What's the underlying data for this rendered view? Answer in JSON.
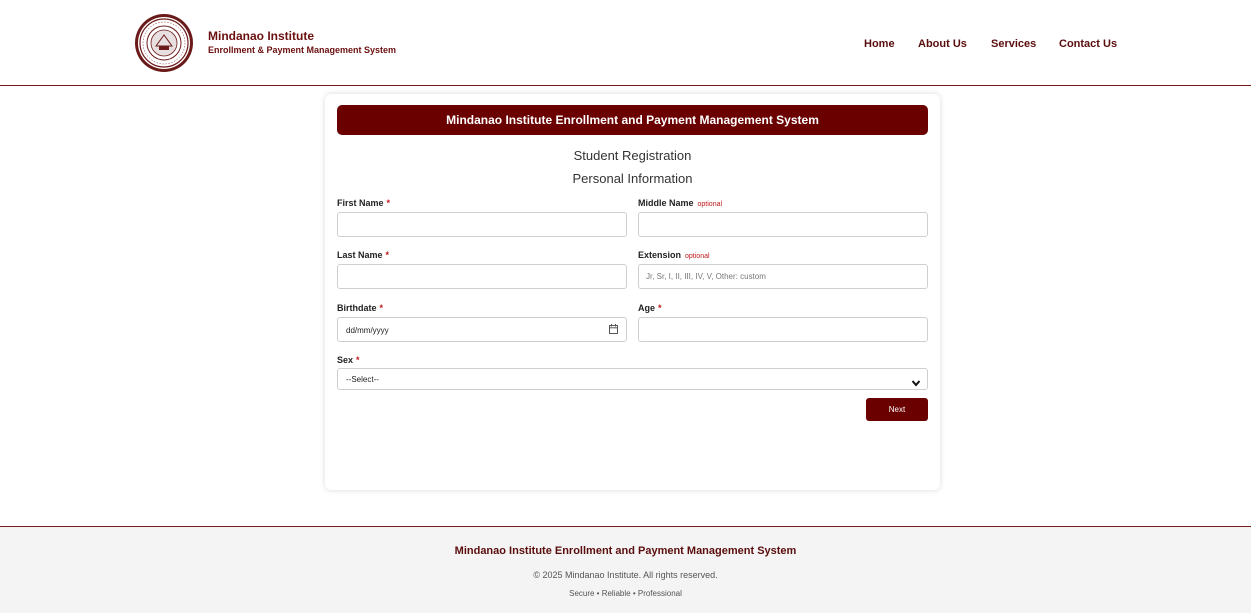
{
  "brand": {
    "name": "Mindanao Institute",
    "subtitle": "Enrollment & Payment Management System",
    "logo_icon": "institute-seal-icon"
  },
  "nav": {
    "home": "Home",
    "about": "About Us",
    "services": "Services",
    "contact": "Contact Us"
  },
  "form": {
    "banner": "Mindanao Institute Enrollment and Payment Management System",
    "heading": "Student Registration",
    "section": "Personal Information",
    "required_mark": "*",
    "optional_text": "optional",
    "first_name": {
      "label": "First Name",
      "value": "",
      "placeholder": ""
    },
    "middle_name": {
      "label": "Middle Name",
      "value": "",
      "placeholder": ""
    },
    "last_name": {
      "label": "Last Name",
      "value": "",
      "placeholder": ""
    },
    "extension": {
      "label": "Extension",
      "value": "",
      "placeholder": "Jr, Sr, I, II, III, IV, V, Other: custom"
    },
    "birthdate": {
      "label": "Birthdate",
      "value": "dd/mm/yyyy"
    },
    "age": {
      "label": "Age",
      "value": "",
      "placeholder": ""
    },
    "sex": {
      "label": "Sex",
      "selected": "--Select--"
    },
    "next_button": "Next"
  },
  "footer": {
    "title": "Mindanao Institute Enrollment and Payment Management System",
    "copyright": "© 2025 Mindanao Institute. All rights reserved.",
    "tagline": "Secure • Reliable • Professional"
  },
  "colors": {
    "primary": "#6b0000",
    "required": "#c0181b",
    "footer_bg": "#f4f4f4"
  }
}
